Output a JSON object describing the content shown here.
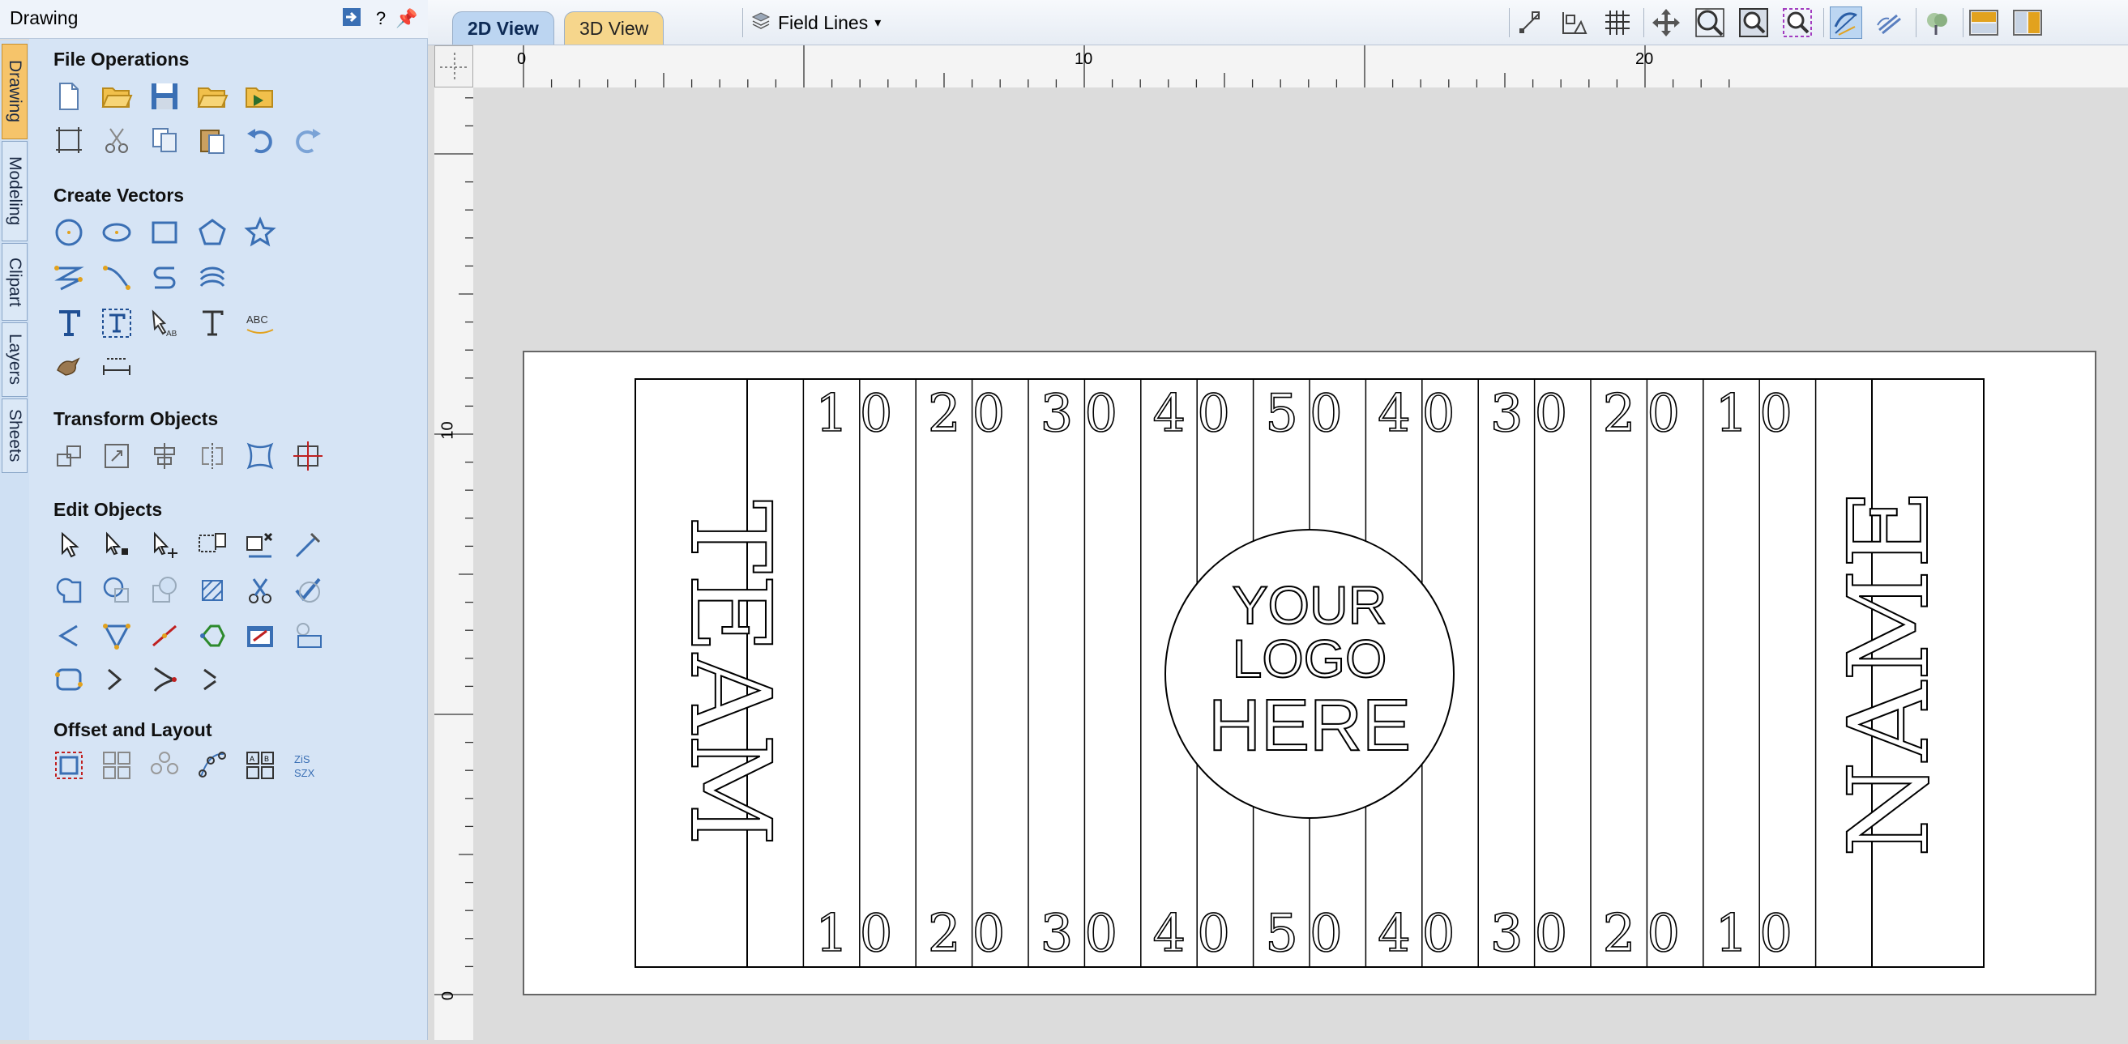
{
  "panel": {
    "title": "Drawing",
    "side_tabs": [
      "Drawing",
      "Modeling",
      "Clipart",
      "Layers",
      "Sheets"
    ],
    "groups": {
      "file_operations": "File Operations",
      "create_vectors": "Create Vectors",
      "transform_objects": "Transform Objects",
      "edit_objects": "Edit Objects",
      "offset_layout": "Offset and Layout"
    }
  },
  "toolbar": {
    "tab_2d": "2D View",
    "tab_3d": "3D View",
    "layer_name": "Field Lines",
    "dropdown_arrow": "▾"
  },
  "rulers": {
    "top": [
      "0",
      "10",
      "20"
    ],
    "left": [
      "10",
      "0"
    ]
  },
  "drawing": {
    "left_word": "TEAM",
    "right_word": "NAME",
    "yard_numbers": [
      "10",
      "20",
      "30",
      "40",
      "50",
      "40",
      "30",
      "20",
      "10"
    ],
    "logo_lines": [
      "YOUR",
      "LOGO",
      "HERE"
    ]
  },
  "colors": {
    "panel_bg": "#d6e4f5",
    "accent_tab": "#f6c46a",
    "icon_blue": "#3a6fb4",
    "icon_gold": "#e2a21e"
  }
}
